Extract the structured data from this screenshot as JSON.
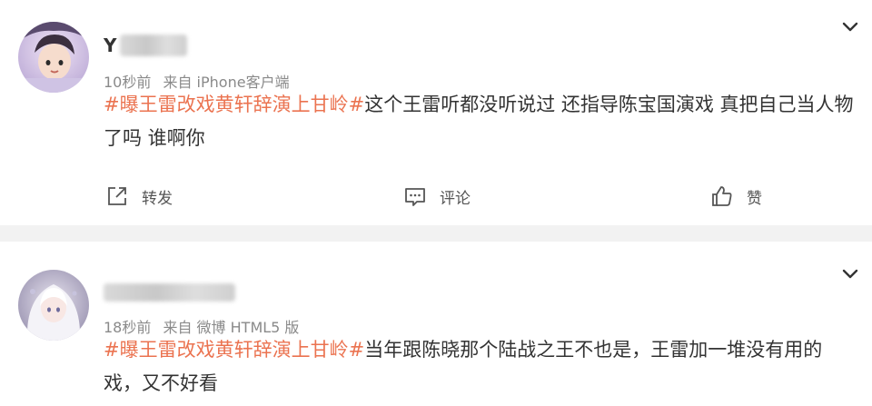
{
  "posts": [
    {
      "username_visible": "Y",
      "time": "10秒前",
      "source": "来自 iPhone客户端",
      "topic": "#曝王雷改戏黄轩辞演上甘岭#",
      "text": "这个王雷听都没听说过 还指导陈宝国演戏 真把自己当人物了吗 谁啊你",
      "actions": {
        "repost_label": "转发",
        "comment_label": "评论",
        "like_label": "赞"
      }
    },
    {
      "time": "18秒前",
      "source": "来自 微博 HTML5 版",
      "topic": "#曝王雷改戏黄轩辞演上甘岭#",
      "text": "当年跟陈晓那个陆战之王不也是，王雷加一堆没有用的戏，又不好看"
    }
  ],
  "colors": {
    "topic": "#eb7350",
    "background": "#f2f2f2",
    "card": "#ffffff",
    "meta": "#8a8a8a"
  },
  "icons": {
    "menu": "chevron-down-icon",
    "repost": "repost-icon",
    "comment": "comment-icon",
    "like": "thumbs-up-icon"
  }
}
